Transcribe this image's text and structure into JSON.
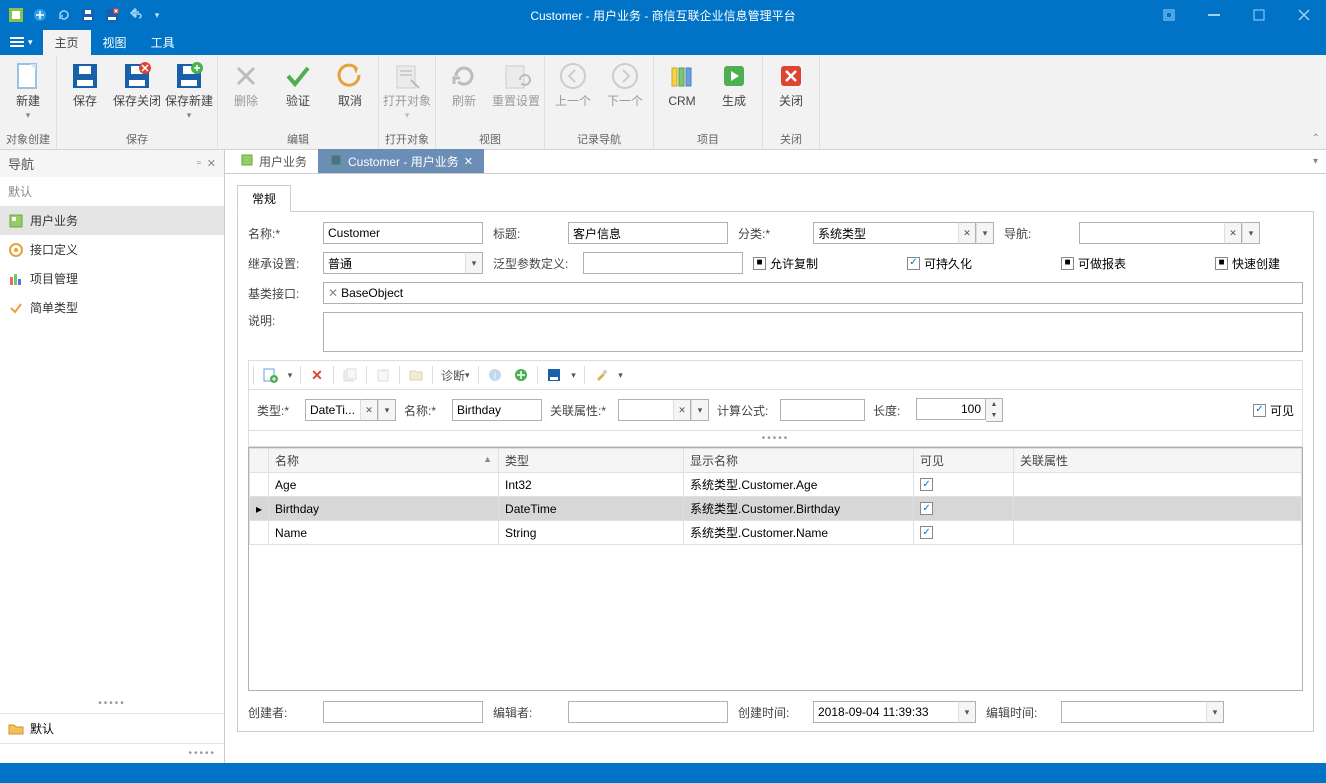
{
  "titlebar": {
    "title": "Customer - 用户业务 - 商信互联企业信息管理平台"
  },
  "menubar": {
    "file": "",
    "tabs": [
      "主页",
      "视图",
      "工具"
    ],
    "active": 0
  },
  "ribbon": {
    "groups": [
      {
        "label": "对象创建",
        "buttons": [
          {
            "id": "new",
            "label": "新建",
            "dd": true
          }
        ]
      },
      {
        "label": "保存",
        "buttons": [
          {
            "id": "save",
            "label": "保存"
          },
          {
            "id": "saveclose",
            "label": "保存关闭"
          },
          {
            "id": "savenew",
            "label": "保存新建",
            "dd": true
          }
        ]
      },
      {
        "label": "编辑",
        "buttons": [
          {
            "id": "delete",
            "label": "删除",
            "disabled": true
          },
          {
            "id": "verify",
            "label": "验证"
          },
          {
            "id": "cancel",
            "label": "取消"
          }
        ]
      },
      {
        "label": "打开对象",
        "buttons": [
          {
            "id": "openobj",
            "label": "打开对象",
            "disabled": true,
            "dd": true
          }
        ]
      },
      {
        "label": "视图",
        "buttons": [
          {
            "id": "refresh",
            "label": "刷新",
            "disabled": true
          },
          {
            "id": "reset",
            "label": "重置设置",
            "disabled": true
          }
        ]
      },
      {
        "label": "记录导航",
        "buttons": [
          {
            "id": "prev",
            "label": "上一个",
            "disabled": true
          },
          {
            "id": "next",
            "label": "下一个",
            "disabled": true
          }
        ]
      },
      {
        "label": "项目",
        "buttons": [
          {
            "id": "crm",
            "label": "CRM"
          },
          {
            "id": "gen",
            "label": "生成"
          }
        ]
      },
      {
        "label": "关闭",
        "buttons": [
          {
            "id": "close",
            "label": "关闭"
          }
        ]
      }
    ]
  },
  "nav": {
    "title": "导航",
    "group": "默认",
    "items": [
      {
        "label": "用户业务",
        "selected": true
      },
      {
        "label": "接口定义"
      },
      {
        "label": "项目管理"
      },
      {
        "label": "简单类型"
      }
    ],
    "footer": "默认"
  },
  "doctabs": [
    {
      "label": "用户业务"
    },
    {
      "label": "Customer - 用户业务",
      "active": true,
      "closable": true
    }
  ],
  "innerTab": "常规",
  "form": {
    "name_l": "名称:*",
    "name_v": "Customer",
    "title_l": "标题:",
    "title_v": "客户信息",
    "cat_l": "分类:*",
    "cat_v": "系统类型",
    "nav_l": "导航:",
    "nav_v": "",
    "inherit_l": "继承设置:",
    "inherit_v": "普通",
    "generic_l": "泛型参数定义:",
    "generic_v": "",
    "copy_l": "允许复制",
    "persist_l": "可持久化",
    "report_l": "可做报表",
    "quick_l": "快速创建",
    "base_l": "基类接口:",
    "base_tag": "BaseObject",
    "desc_l": "说明:",
    "diag": "诊断"
  },
  "subform": {
    "type_l": "类型:*",
    "type_v": "DateTi...",
    "name_l": "名称:*",
    "name_v": "Birthday",
    "rel_l": "关联属性:*",
    "rel_v": "",
    "calc_l": "计算公式:",
    "calc_v": "",
    "len_l": "长度:",
    "len_v": "100",
    "vis_l": "可见"
  },
  "grid": {
    "cols": [
      "名称",
      "类型",
      "显示名称",
      "可见",
      "关联属性"
    ],
    "rows": [
      {
        "name": "Age",
        "type": "Int32",
        "disp": "系统类型.Customer.Age",
        "vis": true
      },
      {
        "name": "Birthday",
        "type": "DateTime",
        "disp": "系统类型.Customer.Birthday",
        "vis": true,
        "selected": true
      },
      {
        "name": "Name",
        "type": "String",
        "disp": "系统类型.Customer.Name",
        "vis": true
      }
    ]
  },
  "footer": {
    "creator_l": "创建者:",
    "creator_v": "",
    "editor_l": "编辑者:",
    "editor_v": "",
    "ctime_l": "创建时间:",
    "ctime_v": "2018-09-04 11:39:33",
    "etime_l": "编辑时间:",
    "etime_v": ""
  }
}
